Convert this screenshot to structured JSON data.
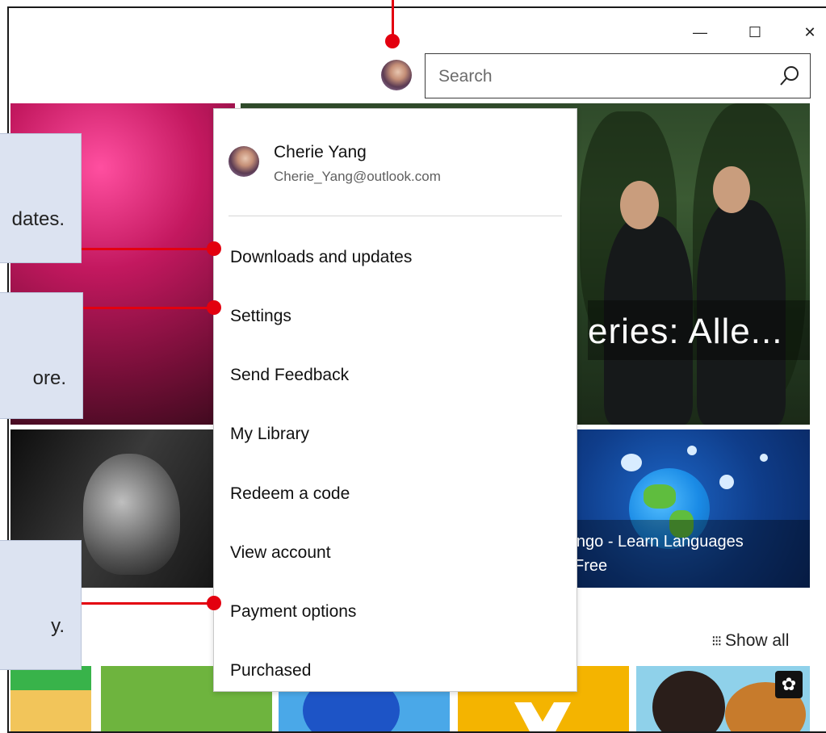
{
  "window": {
    "controls": {
      "minimize": "—",
      "maximize": "☐",
      "close": "✕"
    }
  },
  "search": {
    "placeholder": "Search",
    "icon": "search-icon"
  },
  "account": {
    "name": "Cherie Yang",
    "email": "Cherie_Yang@outlook.com"
  },
  "menu": {
    "items": [
      "Downloads and updates",
      "Settings",
      "Send Feedback",
      "My Library",
      "Redeem a code",
      "View account",
      "Payment options",
      "Purchased"
    ]
  },
  "tiles": {
    "movie_title": "eries: Alle...",
    "duolingo_line1": "lingo - Learn Languages",
    "duolingo_line2": "Free"
  },
  "show_all": {
    "icon": "grid-dots-icon",
    "label": "Show all"
  },
  "callouts": {
    "downloads": "dates.",
    "settings": "ore.",
    "payment": "y."
  },
  "colors": {
    "annotation_red": "#e3000f",
    "callout_bg": "#dce3f1",
    "menu_bg": "#ffffff"
  }
}
